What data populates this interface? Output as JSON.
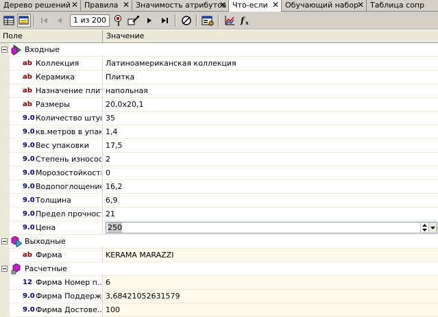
{
  "tabs": [
    {
      "label": "Дерево решений",
      "active": false
    },
    {
      "label": "Правила",
      "active": false
    },
    {
      "label": "Значимость атрибутов",
      "active": false
    },
    {
      "label": "Что-если",
      "active": true
    },
    {
      "label": "Обучающий набор",
      "active": false
    },
    {
      "label": "Таблица сопр",
      "active": false
    }
  ],
  "toolbar": {
    "pager": "1 из 200",
    "buttons": [
      "table-icon",
      "card-view-icon",
      "first-record-icon",
      "prev-record-icon",
      "find-icon",
      "edit-icon",
      "next-record-icon",
      "last-record-icon",
      "eraser-icon",
      "settings-icon",
      "chart-icon",
      "formula-icon"
    ]
  },
  "grid": {
    "col_field": "Поле",
    "col_value": "Значение"
  },
  "groups": [
    {
      "title": "Входные",
      "icon": "input-group-icon",
      "rows": [
        {
          "type": "ab",
          "name": "Коллекция",
          "value": "Латиноамериканская коллекция"
        },
        {
          "type": "ab",
          "name": "Керамика",
          "value": "Плитка"
        },
        {
          "type": "ab",
          "name": "Назначение плит...",
          "value": "напольная"
        },
        {
          "type": "ab",
          "name": "Размеры",
          "value": "20,0х20,1"
        },
        {
          "type": "9.0",
          "name": "Количество штук",
          "value": "35"
        },
        {
          "type": "9.0",
          "name": "кв.метров в упак...",
          "value": "1,4"
        },
        {
          "type": "9.0",
          "name": "Вес упаковки",
          "value": "17,5"
        },
        {
          "type": "9.0",
          "name": "Степень износос...",
          "value": "2"
        },
        {
          "type": "9.0",
          "name": "Морозостойкость",
          "value": "0"
        },
        {
          "type": "9.0",
          "name": "Водопоглощение",
          "value": "16,2"
        },
        {
          "type": "9.0",
          "name": "Толщина",
          "value": "6,9"
        },
        {
          "type": "9.0",
          "name": "Предел прочности",
          "value": "21"
        },
        {
          "type": "9.0",
          "name": "Цена",
          "value": "250",
          "editing": true
        }
      ]
    },
    {
      "title": "Выходные",
      "icon": "output-group-icon",
      "rows": [
        {
          "type": "ab",
          "name": "Фирма",
          "value": "KERAMA MARAZZI"
        }
      ]
    },
    {
      "title": "Расчетные",
      "icon": "calculated-group-icon",
      "rows": [
        {
          "type": "12",
          "name": "Фирма Номер п...",
          "value": "6"
        },
        {
          "type": "9.0",
          "name": "Фирма Поддерж...",
          "value": "3,68421052631579"
        },
        {
          "type": "9.0",
          "name": "Фирма Достове...",
          "value": "100"
        }
      ]
    }
  ]
}
